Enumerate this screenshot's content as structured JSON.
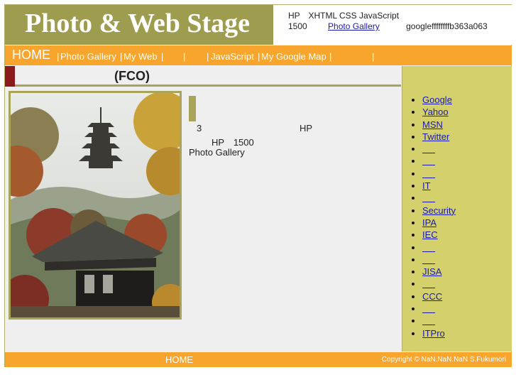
{
  "header": {
    "logo_text": "Photo & Web Stage",
    "info_line1": "HP　XHTML CSS JavaScript",
    "info_count": "1500",
    "info_link": "Photo Gallery",
    "info_code": "googleffffffffb363a063"
  },
  "nav": {
    "home": "HOME",
    "items": [
      "Photo Gallery",
      "My Web",
      "",
      "",
      "JavaScript",
      "My Google Map",
      ""
    ]
  },
  "page_title": "(FCO)",
  "main": {
    "line1_num": "3",
    "line1_hp": "HP",
    "line2": "HP　1500",
    "line3": "Photo Gallery"
  },
  "sidebar": {
    "links": [
      "Google",
      "Yahoo",
      "MSN",
      "Twitter",
      "",
      "",
      "",
      "IT",
      "",
      "Security",
      "IPA",
      "IEC",
      "",
      "",
      "JISA",
      "",
      "CCC",
      "",
      "",
      "ITPro"
    ]
  },
  "footer": {
    "home": "HOME",
    "copyright": "Copyright © NaN.NaN.NaN S.Fukumori"
  },
  "colors": {
    "olive": "#9e9c4e",
    "orange": "#f7a52c",
    "sidebar": "#d4d06c",
    "maroon": "#8b1a1a"
  }
}
